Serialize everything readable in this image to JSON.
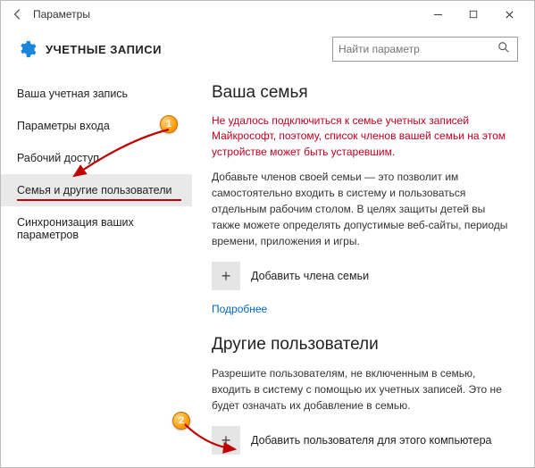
{
  "window": {
    "title": "Параметры"
  },
  "header": {
    "page_title": "УЧЕТНЫЕ ЗАПИСИ",
    "search_placeholder": "Найти параметр"
  },
  "sidebar": {
    "items": [
      {
        "label": "Ваша учетная запись"
      },
      {
        "label": "Параметры входа"
      },
      {
        "label": "Рабочий доступ"
      },
      {
        "label": "Семья и другие пользователи"
      },
      {
        "label": "Синхронизация ваших параметров"
      }
    ],
    "active_index": 3
  },
  "content": {
    "family": {
      "heading": "Ваша семья",
      "error": "Не удалось подключиться к семье учетных записей Майкрософт, поэтому, список членов вашей семьи на этом устройстве может быть устаревшим.",
      "description": "Добавьте членов своей семьи — это позволит им самостоятельно входить в систему и пользоваться отдельным рабочим столом. В целях защиты детей вы также можете определять допустимые веб-сайты, периоды времени, приложения и игры.",
      "add_label": "Добавить члена семьи",
      "more_link": "Подробнее"
    },
    "others": {
      "heading": "Другие пользователи",
      "description": "Разрешите пользователям, не включенным в семью, входить в систему с помощью их учетных записей. Это не будет означать их добавление в семью.",
      "add_label": "Добавить пользователя для этого компьютера"
    }
  },
  "annotations": {
    "badge1": "1",
    "badge2": "2"
  }
}
